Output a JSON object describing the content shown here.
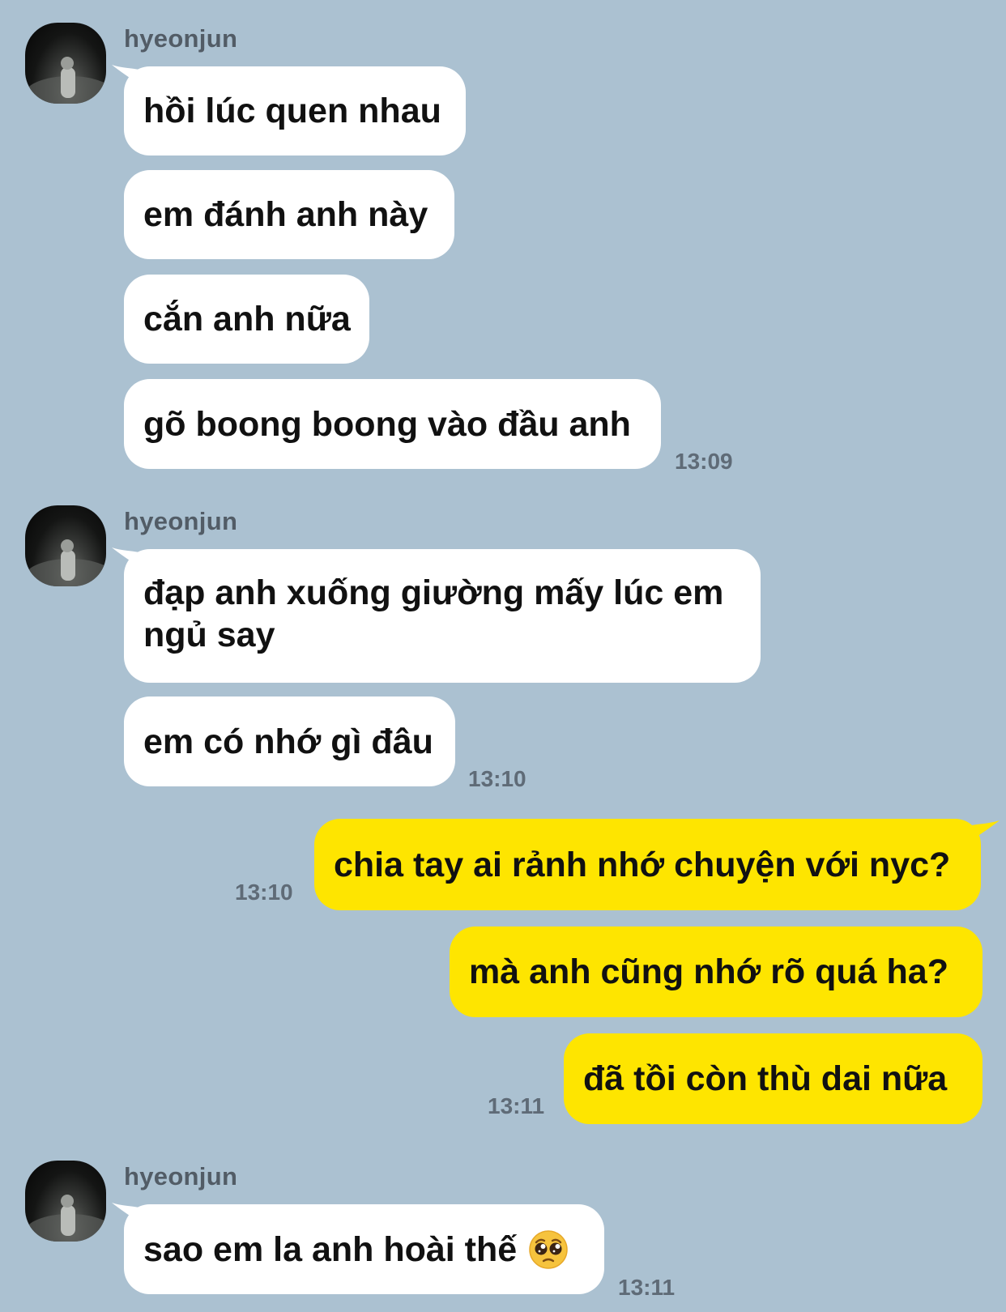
{
  "colors": {
    "background": "#abc1d1",
    "incoming_bubble": "#ffffff",
    "outgoing_bubble": "#fee500",
    "timestamp": "#5f6b77",
    "sender_name": "#525c66"
  },
  "groups": [
    {
      "sender": "hyeonjun",
      "messages": [
        "hồi lúc quen nhau",
        "em đánh anh này",
        "cắn anh nữa",
        "gõ boong boong vào đầu anh"
      ],
      "time": "13:09"
    },
    {
      "sender": "hyeonjun",
      "messages": [
        "đạp anh xuống giường mấy lúc em ngủ say",
        "em có nhớ gì đâu"
      ],
      "time": "13:10"
    },
    {
      "sender": "me",
      "outgoing": true,
      "messages": [
        {
          "text": "chia tay ai rảnh nhớ chuyện với nyc?",
          "time": "13:10"
        },
        {
          "text": "mà anh cũng nhớ rõ quá ha?"
        },
        {
          "text": "đã tồi còn thù dai nữa",
          "time": "13:11"
        }
      ]
    },
    {
      "sender": "hyeonjun",
      "messages": [
        {
          "text": "sao em la anh hoài thế",
          "emoji": "pleading-face-emoji"
        }
      ],
      "time": "13:11"
    }
  ]
}
